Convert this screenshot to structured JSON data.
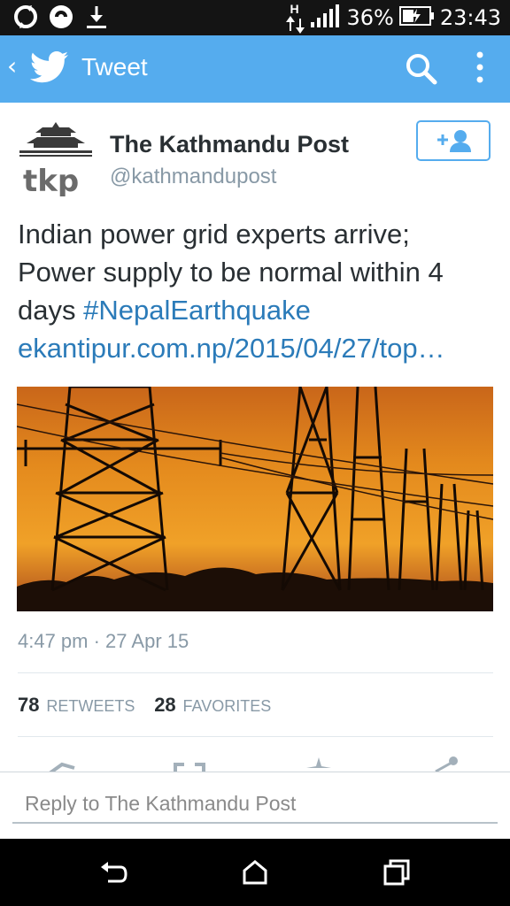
{
  "status_bar": {
    "battery_percent": "36%",
    "time": "23:43",
    "network_type": "H",
    "icons": [
      "sync-icon",
      "circular-app-icon",
      "download-icon",
      "data-arrows-icon",
      "signal-bars-icon",
      "battery-charging-icon"
    ]
  },
  "action_bar": {
    "title": "Tweet",
    "icons": [
      "back-chevron-icon",
      "twitter-bird-icon",
      "search-icon",
      "overflow-menu-icon"
    ],
    "color": "#55acee"
  },
  "tweet": {
    "author_name": "The Kathmandu Post",
    "author_handle": "@kathmandupost",
    "avatar_text": "tkp",
    "text_line1": "Indian power grid experts arrive;",
    "text_line2": "Power supply to be normal within 4",
    "text_line3_plain": "days ",
    "hashtag": "#NepalEarthquake",
    "link": "ekantipur.com.np/2015/04/27/top…",
    "timestamp": "4:47 pm · 27 Apr 15",
    "retweets_count": "78",
    "retweets_label": "RETWEETS",
    "favorites_count": "28",
    "favorites_label": "FAVORITES"
  },
  "reply": {
    "placeholder": "Reply to The Kathmandu Post"
  },
  "colors": {
    "link": "#2b7bb9",
    "muted": "#8899a6",
    "text": "#292f33"
  }
}
